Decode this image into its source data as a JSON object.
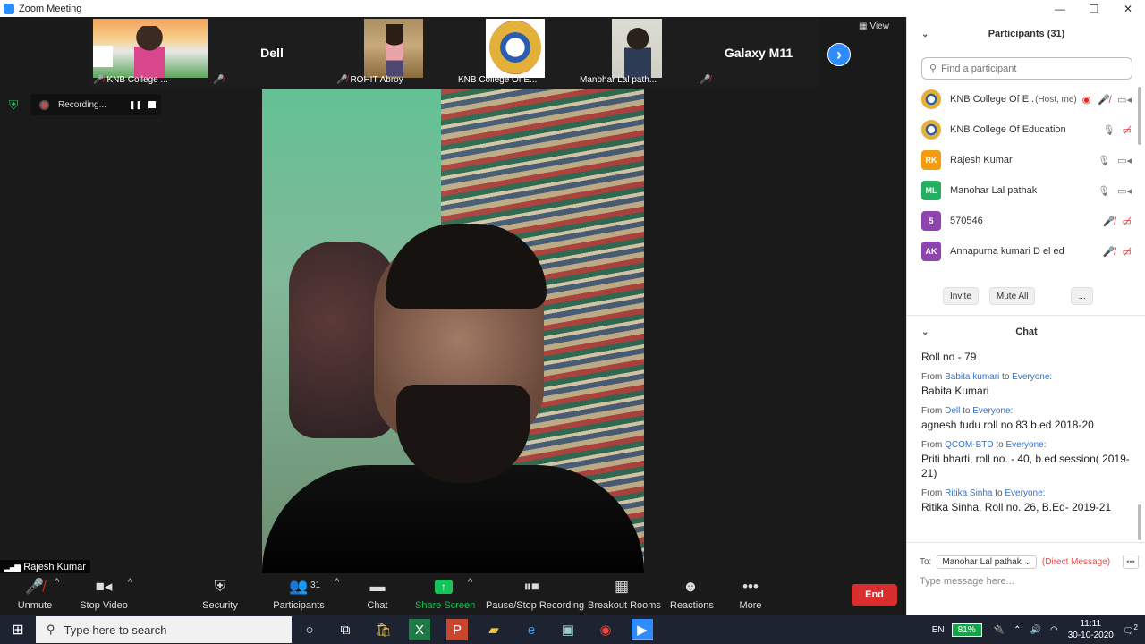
{
  "window": {
    "title": "Zoom Meeting",
    "controls": [
      "—",
      "❐",
      "✕"
    ]
  },
  "thumbnails": [
    {
      "name": "KNB College ...",
      "big": "",
      "muted": true
    },
    {
      "name": "",
      "big": "Dell",
      "muted": true
    },
    {
      "name": "ROHIT Abroy",
      "big": "",
      "muted": true
    },
    {
      "name": "KNB College Of E...",
      "big": "",
      "muted": false
    },
    {
      "name": "Manohar Lal path...",
      "big": "",
      "muted": false
    },
    {
      "name": "",
      "big": "Galaxy M11",
      "muted": true
    }
  ],
  "view_label": "View",
  "recording_label": "Recording...",
  "active_speaker": "Rajesh Kumar",
  "toolbar": {
    "unmute": "Unmute",
    "stop_video": "Stop Video",
    "security": "Security",
    "participants": "Participants",
    "participants_count": "31",
    "chat": "Chat",
    "share_screen": "Share Screen",
    "pause_stop_recording": "Pause/Stop Recording",
    "breakout_rooms": "Breakout Rooms",
    "reactions": "Reactions",
    "more": "More",
    "end": "End"
  },
  "participants_panel": {
    "title": "Participants (31)",
    "search_placeholder": "Find a participant",
    "rows": [
      {
        "initials": "",
        "name": "KNB College Of E...",
        "role": "(Host, me)",
        "avatar_color": "logo"
      },
      {
        "initials": "",
        "name": "KNB College Of Education",
        "role": "",
        "avatar_color": "logo"
      },
      {
        "initials": "RK",
        "name": "Rajesh Kumar",
        "role": "",
        "avatar_color": "#f39c12"
      },
      {
        "initials": "ML",
        "name": "Manohar Lal pathak",
        "role": "",
        "avatar_color": "#27ae60"
      },
      {
        "initials": "5",
        "name": "570546",
        "role": "",
        "avatar_color": "#8e44ad"
      },
      {
        "initials": "AK",
        "name": "Annapurna kumari D el ed",
        "role": "",
        "avatar_color": "#8e44ad"
      }
    ],
    "invite": "Invite",
    "mute_all": "Mute All",
    "more": "..."
  },
  "chat_panel": {
    "title": "Chat",
    "first_line": "Roll no - 79",
    "messages": [
      {
        "from": "Babita kumari",
        "to": "Everyone:",
        "text": "Babita Kumari"
      },
      {
        "from": "Dell",
        "to": "Everyone:",
        "text": "agnesh tudu roll no 83 b.ed 2018-20"
      },
      {
        "from": "QCOM-BTD",
        "to": "Everyone:",
        "text": "Priti bharti, roll no. - 40, b.ed session( 2019-21)"
      },
      {
        "from": "Ritika Sinha",
        "to": "Everyone:",
        "text": "Ritika Sinha, Roll no. 26, B.Ed- 2019-21"
      }
    ],
    "from_word": "From",
    "to_word": "to",
    "to_label": "To:",
    "to_recipient": "Manohar Lal pathak",
    "direct_message": "(Direct Message)",
    "input_placeholder": "Type message here..."
  },
  "taskbar": {
    "search_placeholder": "Type here to search",
    "language": "EN",
    "battery": "81%",
    "time": "11:11",
    "date": "30-10-2020",
    "notifications": "2"
  }
}
